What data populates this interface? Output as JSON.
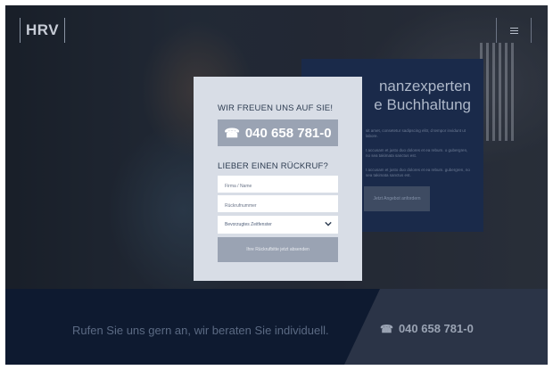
{
  "header": {
    "logo": "HRV",
    "menu_icon": "hamburger-icon"
  },
  "info_card": {
    "title_line1": "nanzexperten",
    "title_line2": "e Buchhaltung",
    "para1": "sit amet, consetetur sadipscing elitr, d tempor invidunt ut labore.",
    "para2": "t accusam et justo duo dolores et ea rebum. o gubergren, no sea takimata sanctus est.",
    "para3": "t accusam et justo duo dolores et ea rebum. gubergren, no sea takimata sanctus est.",
    "button": "Jetzt Angebot anfordern"
  },
  "form": {
    "heading": "WIR FREUEN UNS AUF SIE!",
    "phone": "040 658 781-0",
    "phone_icon": "telephone-icon",
    "subheading": "LIEBER EINEN RÜCKRUF?",
    "company_placeholder": "Firma / Name",
    "callback_placeholder": "Rückrufnummer",
    "time_select": "Bevorzugtes Zeitfenster",
    "submit": "Ihre Rückrufbitte jetzt absenden"
  },
  "footer": {
    "text": "Rufen Sie uns gern an, wir beraten Sie individuell.",
    "phone": "040 658 781-0",
    "phone_icon": "telephone-icon"
  },
  "colors": {
    "navy": "#0e1a30",
    "card_blue": "#1a2a4a",
    "form_bg": "#d8dde6",
    "button_gray": "#9aa3b3"
  }
}
